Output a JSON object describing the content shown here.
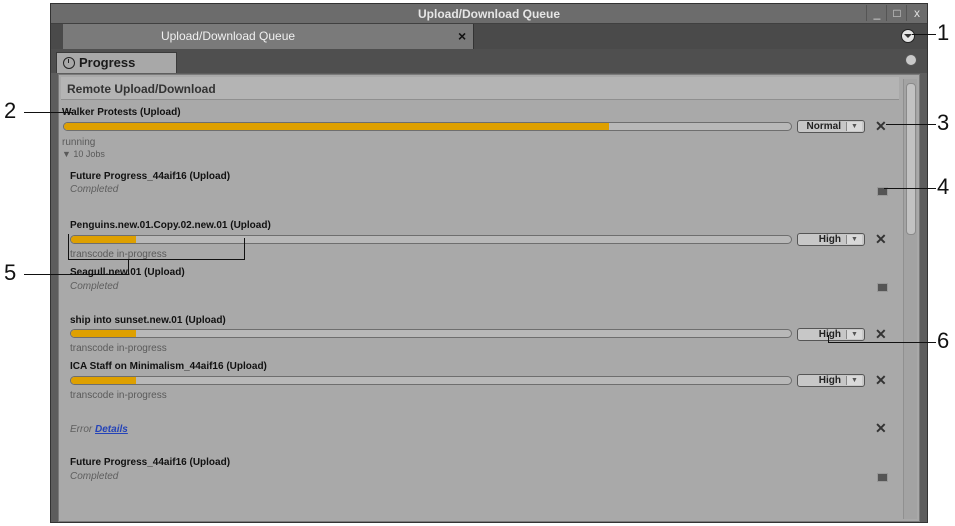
{
  "window": {
    "title": "Upload/Download Queue",
    "minimize_label": "_",
    "restore_label": "□",
    "close_label": "x"
  },
  "document_tab": {
    "label": "Upload/Download Queue",
    "close_label": "×"
  },
  "panel_tab": {
    "label": "Progress"
  },
  "section": {
    "title": "Remote Upload/Download"
  },
  "main_job": {
    "title": "Walker Protests (Upload)",
    "status": "running",
    "jobs_toggle": "▼ 10 Jobs",
    "progress": 0.75,
    "priority": "Normal"
  },
  "jobs": [
    {
      "title": "Future Progress_44aif16 (Upload)",
      "status": "Completed"
    },
    {
      "title": "Penguins.new.01.Copy.02.new.01 (Upload)",
      "status": "transcode in-progress",
      "progress": 0.09,
      "priority": "High"
    },
    {
      "title": "Seagull.new.01 (Upload)",
      "status": "Completed"
    },
    {
      "title": "ship into sunset.new.01 (Upload)",
      "status": "transcode in-progress",
      "progress": 0.09,
      "priority": "High"
    },
    {
      "title": "ICA Staff on Minimalism_44aif16 (Upload)",
      "status": "transcode in-progress",
      "progress": 0.09,
      "priority": "High"
    },
    {
      "error_label": "Error",
      "details_label": "Details"
    },
    {
      "title": "Future Progress_44aif16 (Upload)",
      "status": "Completed"
    }
  ],
  "dropdown_arrow": "▼",
  "remove_label": "✕",
  "callouts": [
    "1",
    "2",
    "3",
    "4",
    "5",
    "6"
  ],
  "colors": {
    "progress": "#dea000",
    "panel": "#a9a9a9",
    "link": "#2443b8"
  }
}
